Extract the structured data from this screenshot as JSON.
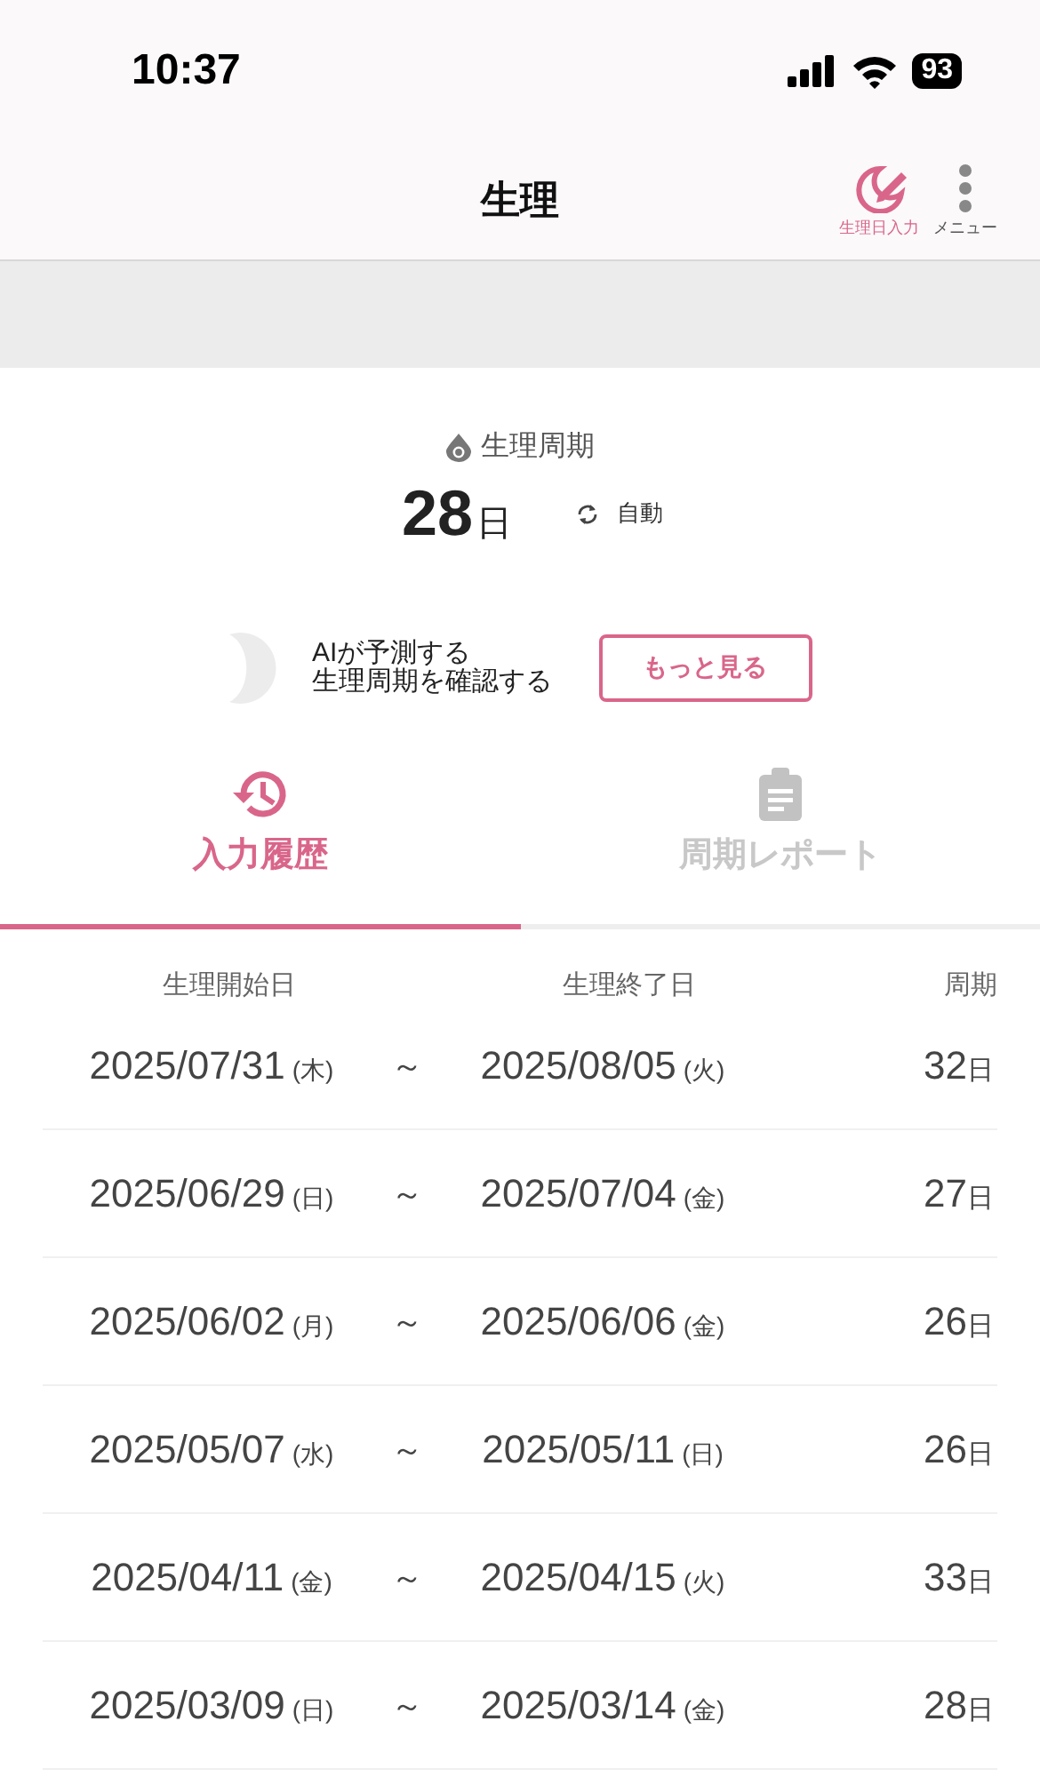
{
  "status_bar": {
    "time": "10:37",
    "battery": "93"
  },
  "header": {
    "title": "生理",
    "actions": [
      {
        "kind": "entry",
        "label": "生理日入力"
      },
      {
        "kind": "menu",
        "label": "メニュー"
      }
    ]
  },
  "cycle": {
    "label": "生理周期",
    "value": "28",
    "unit": "日",
    "mode": "自動"
  },
  "ai_banner": {
    "lines": [
      "AIが予測する",
      "生理周期を確認する"
    ],
    "button": "もっと見る"
  },
  "tabs": [
    {
      "kind": "history",
      "label": "入力履歴",
      "selected": true
    },
    {
      "kind": "report",
      "label": "周期レポート",
      "selected": false
    }
  ],
  "table": {
    "columns": [
      "生理開始日",
      "生理終了日",
      "周期"
    ],
    "separator": "～",
    "rows": [
      {
        "start": "2025/07/31",
        "start_day": "(木)",
        "end": "2025/08/05",
        "end_day": "(火)",
        "cycle": "32",
        "unit": "日"
      },
      {
        "start": "2025/06/29",
        "start_day": "(日)",
        "end": "2025/07/04",
        "end_day": "(金)",
        "cycle": "27",
        "unit": "日"
      },
      {
        "start": "2025/06/02",
        "start_day": "(月)",
        "end": "2025/06/06",
        "end_day": "(金)",
        "cycle": "26",
        "unit": "日"
      },
      {
        "start": "2025/05/07",
        "start_day": "(水)",
        "end": "2025/05/11",
        "end_day": "(日)",
        "cycle": "26",
        "unit": "日"
      },
      {
        "start": "2025/04/11",
        "start_day": "(金)",
        "end": "2025/04/15",
        "end_day": "(火)",
        "cycle": "33",
        "unit": "日"
      },
      {
        "start": "2025/03/09",
        "start_day": "(日)",
        "end": "2025/03/14",
        "end_day": "(金)",
        "cycle": "28",
        "unit": "日"
      }
    ]
  }
}
